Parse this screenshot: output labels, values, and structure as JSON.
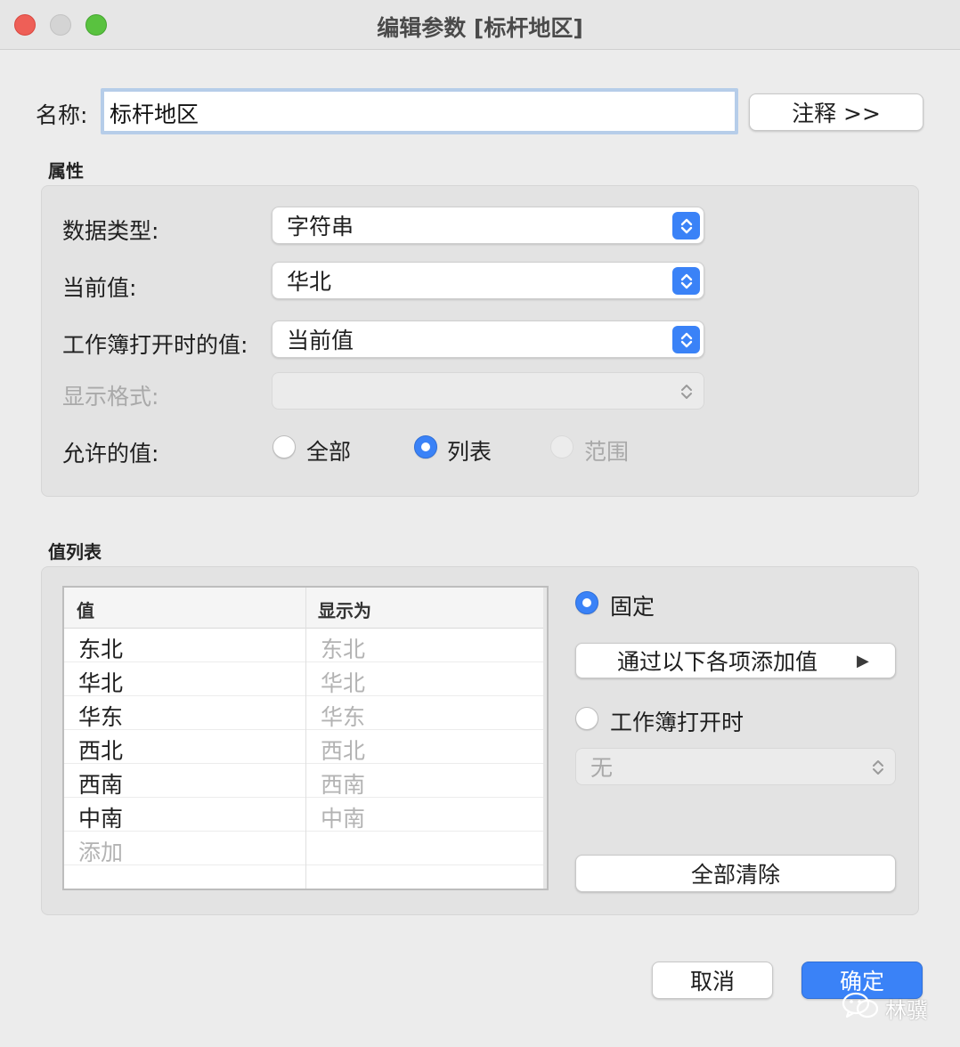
{
  "window": {
    "title": "编辑参数 [标杆地区]"
  },
  "name_row": {
    "label": "名称:",
    "value": "标杆地区",
    "comment_button": "注释 >>"
  },
  "properties": {
    "title": "属性",
    "data_type": {
      "label": "数据类型:",
      "value": "字符串"
    },
    "current_value": {
      "label": "当前值:",
      "value": "华北"
    },
    "workbook_open_value": {
      "label": "工作簿打开时的值:",
      "value": "当前值"
    },
    "display_format": {
      "label": "显示格式:",
      "value": ""
    },
    "allowed_values": {
      "label": "允许的值:",
      "options": [
        {
          "label": "全部",
          "state": "off"
        },
        {
          "label": "列表",
          "state": "on"
        },
        {
          "label": "范围",
          "state": "disabled"
        }
      ]
    }
  },
  "value_list": {
    "title": "值列表",
    "columns": [
      "值",
      "显示为"
    ],
    "rows": [
      {
        "value": "东北",
        "display": "东北"
      },
      {
        "value": "华北",
        "display": "华北"
      },
      {
        "value": "华东",
        "display": "华东"
      },
      {
        "value": "西北",
        "display": "西北"
      },
      {
        "value": "西南",
        "display": "西南"
      },
      {
        "value": "中南",
        "display": "中南"
      }
    ],
    "add_placeholder": "添加",
    "fixed_label": "固定",
    "add_values_from": "通过以下各项添加值",
    "when_workbook_opens": "工作簿打开时",
    "workbook_source": "无",
    "clear_all": "全部清除"
  },
  "footer": {
    "cancel": "取消",
    "ok": "确定"
  },
  "watermark": {
    "text": "林骥"
  },
  "colors": {
    "accent": "#3a82f7",
    "close": "#ee5f57",
    "maximize": "#59c23f"
  }
}
